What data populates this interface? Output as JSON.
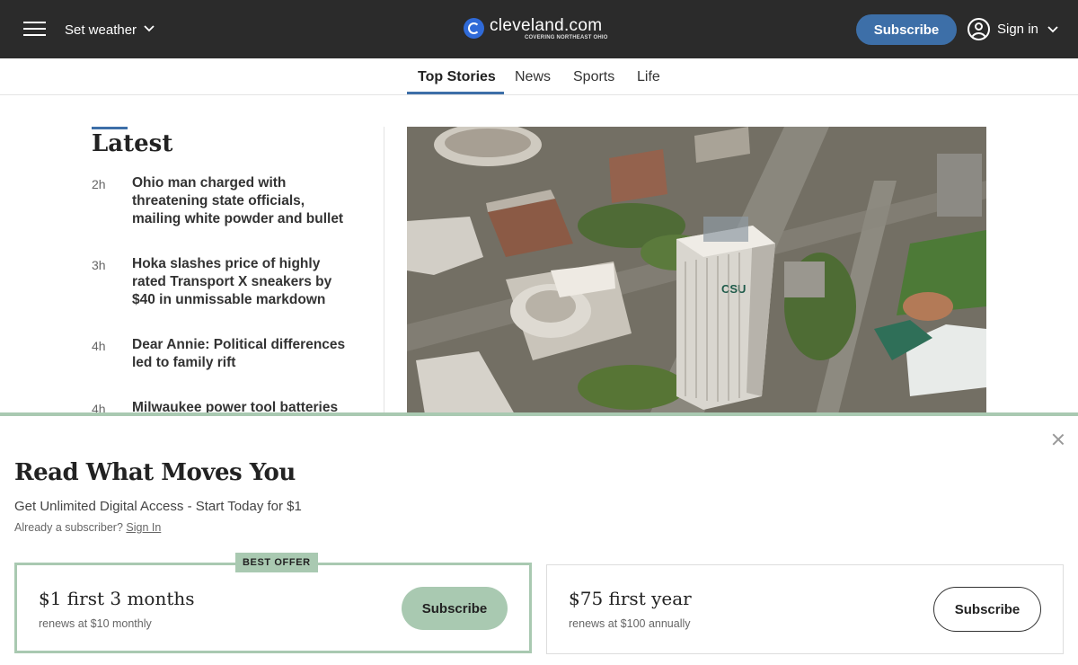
{
  "header": {
    "weather_label": "Set weather",
    "logo_text": "cleveland.com",
    "logo_tagline": "COVERING NORTHEAST OHIO",
    "subscribe_label": "Subscribe",
    "signin_label": "Sign in",
    "brand_color": "#2b2b2b",
    "accent_color": "#3d6fa8"
  },
  "nav": {
    "tabs": [
      {
        "label": "Top Stories",
        "active": true
      },
      {
        "label": "News",
        "active": false
      },
      {
        "label": "Sports",
        "active": false
      },
      {
        "label": "Life",
        "active": false
      }
    ]
  },
  "latest": {
    "title": "Latest",
    "stories": [
      {
        "age": "2h",
        "headline": "Ohio man charged with threatening state officials, mailing white powder and bullet"
      },
      {
        "age": "3h",
        "headline": "Hoka slashes price of highly rated Transport X sneakers by $40 in unmissable markdown"
      },
      {
        "age": "4h",
        "headline": "Dear Annie: Political differences led to family rift"
      },
      {
        "age": "4h",
        "headline": "Milwaukee power tool batteries"
      }
    ]
  },
  "hero": {
    "building_sign": "CSU"
  },
  "paywall": {
    "title": "Read What Moves You",
    "subtitle": "Get Unlimited Digital Access - Start Today for $1",
    "already_text": "Already a subscriber?",
    "signin_link": "Sign In",
    "accent_color": "#a9c9b1",
    "offers": [
      {
        "badge": "BEST OFFER",
        "price": "$1 first 3 months",
        "renews": "renews at $10 monthly",
        "button": "Subscribe"
      },
      {
        "price": "$75 first year",
        "renews": "renews at $100 annually",
        "button": "Subscribe"
      }
    ]
  }
}
